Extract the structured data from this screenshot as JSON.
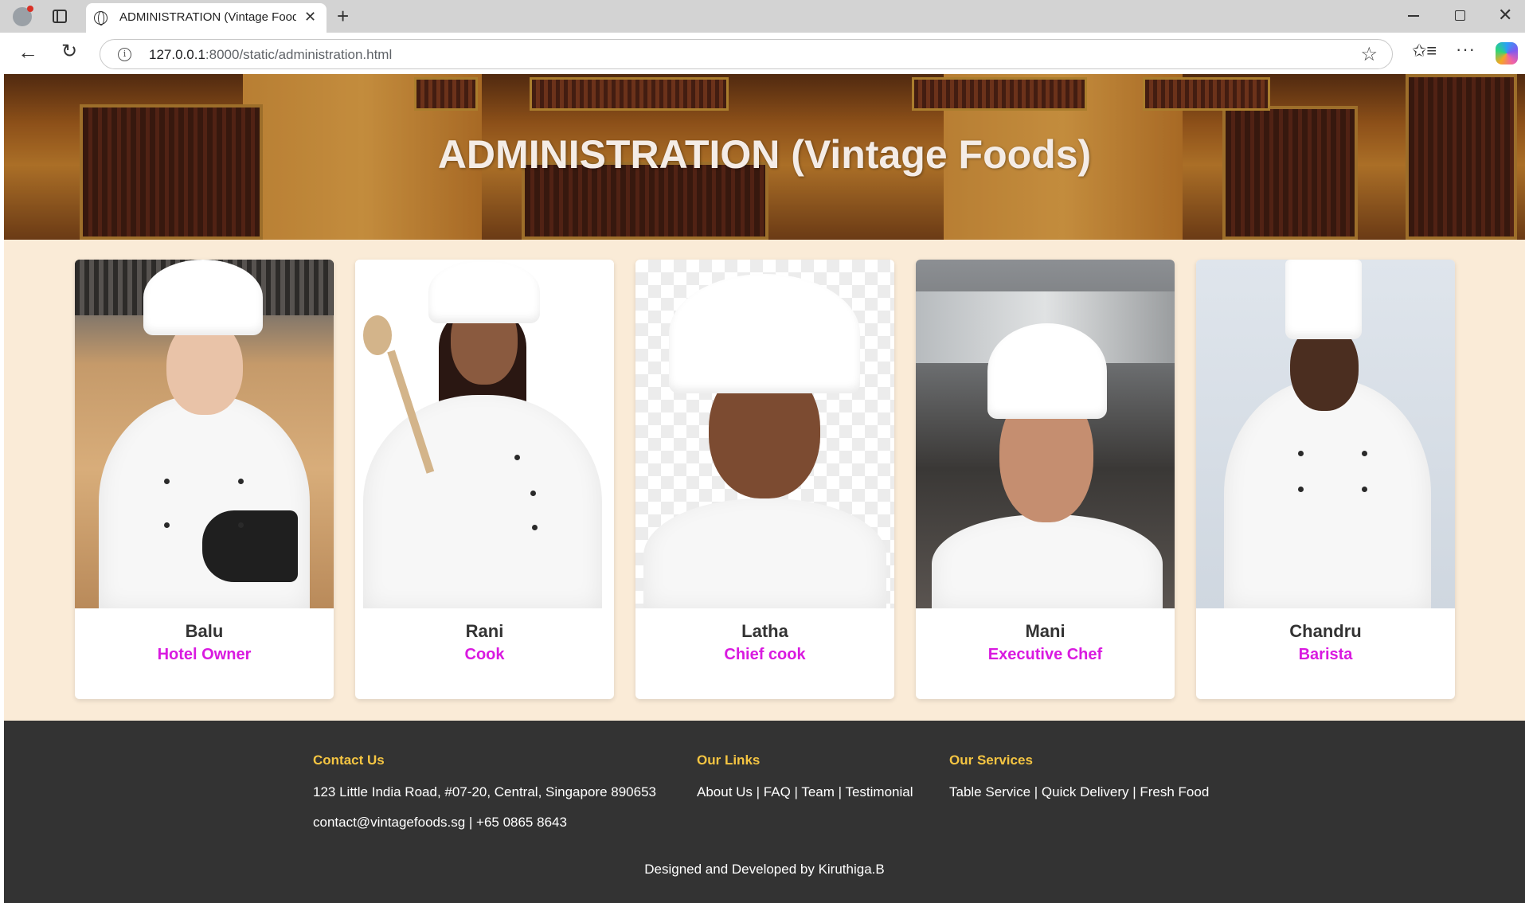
{
  "browser": {
    "tab_title": "ADMINISTRATION (Vintage Foods)",
    "tab_close": "✕",
    "new_tab": "+",
    "url_host": "127.0.0.1",
    "url_rest": ":8000/static/administration.html",
    "icons": [
      "profile-icon",
      "tab-actions-icon",
      "globe-icon",
      "close-icon",
      "plus-icon",
      "minimize-icon",
      "maximize-icon",
      "window-close-icon",
      "back-icon",
      "reload-icon",
      "info-icon",
      "star-icon",
      "favorites-icon",
      "more-icon",
      "copilot-icon"
    ],
    "back_glyph": "←",
    "reload_glyph": "↻",
    "info_glyph": "i",
    "star_glyph": "☆",
    "favorites_glyph": "✩≡",
    "more_glyph": "···",
    "close_glyph": "✕"
  },
  "hero": {
    "title": "ADMINISTRATION (Vintage Foods)"
  },
  "team": [
    {
      "name": "Balu",
      "role": "Hotel Owner"
    },
    {
      "name": "Rani",
      "role": "Cook"
    },
    {
      "name": "Latha",
      "role": "Chief cook"
    },
    {
      "name": "Mani",
      "role": "Executive Chef"
    },
    {
      "name": "Chandru",
      "role": "Barista"
    }
  ],
  "footer": {
    "contact": {
      "heading": "Contact Us",
      "address": "123 Little India Road, #07-20, Central, Singapore 890653",
      "email_phone": "contact@vintagefoods.sg | +65 0865 8643"
    },
    "links": {
      "heading": "Our Links",
      "items": "About Us | FAQ | Team | Testimonial"
    },
    "services": {
      "heading": "Our Services",
      "items": "Table Service | Quick Delivery | Fresh Food"
    },
    "credit": "Designed and Developed by Kiruthiga.B"
  },
  "colors": {
    "page_bg": "#faebd7",
    "role_accent": "#d91ae0",
    "footer_bg": "#333333",
    "footer_heading": "#f5c542"
  }
}
